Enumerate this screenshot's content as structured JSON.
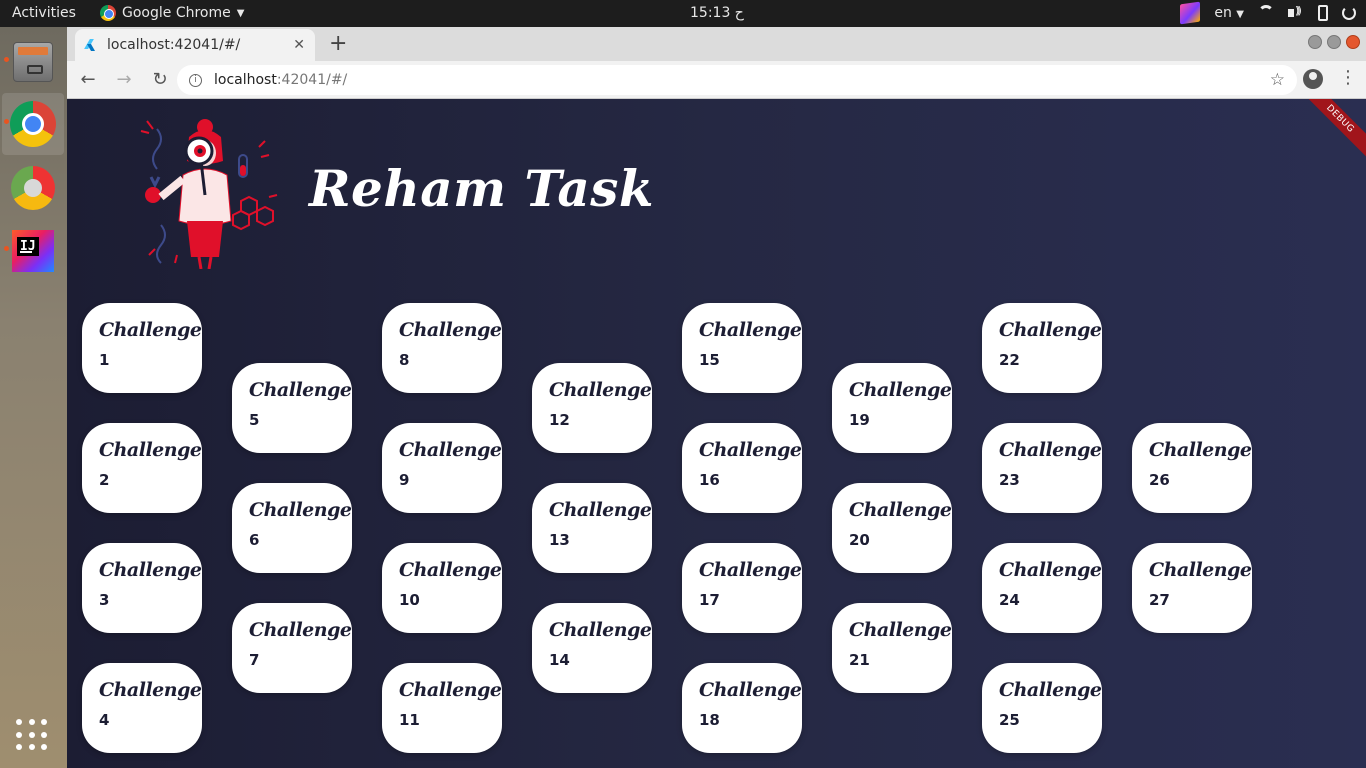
{
  "system_bar": {
    "activities": "Activities",
    "app_name": "Google Chrome",
    "clock": "15:13 ح",
    "language": "en"
  },
  "browser": {
    "tab_title": "localhost:42041/#/",
    "url_host": "localhost",
    "url_path": ":42041/#/"
  },
  "page": {
    "title": "Reham Task",
    "debug_banner": "DEBUG",
    "challenge_label": "Challenge",
    "challenges": [
      {
        "label": "Challenge",
        "number": "1"
      },
      {
        "label": "Challenge",
        "number": "2"
      },
      {
        "label": "Challenge",
        "number": "3"
      },
      {
        "label": "Challenge",
        "number": "4"
      },
      {
        "label": "Challenge",
        "number": "5"
      },
      {
        "label": "Challenge",
        "number": "6"
      },
      {
        "label": "Challenge",
        "number": "7"
      },
      {
        "label": "Challenge",
        "number": "8"
      },
      {
        "label": "Challenge",
        "number": "9"
      },
      {
        "label": "Challenge",
        "number": "10"
      },
      {
        "label": "Challenge",
        "number": "11"
      },
      {
        "label": "Challenge",
        "number": "12"
      },
      {
        "label": "Challenge",
        "number": "13"
      },
      {
        "label": "Challenge",
        "number": "14"
      },
      {
        "label": "Challenge",
        "number": "15"
      },
      {
        "label": "Challenge",
        "number": "16"
      },
      {
        "label": "Challenge",
        "number": "17"
      },
      {
        "label": "Challenge",
        "number": "18"
      },
      {
        "label": "Challenge",
        "number": "19"
      },
      {
        "label": "Challenge",
        "number": "20"
      },
      {
        "label": "Challenge",
        "number": "21"
      },
      {
        "label": "Challenge",
        "number": "22"
      },
      {
        "label": "Challenge",
        "number": "23"
      },
      {
        "label": "Challenge",
        "number": "24"
      },
      {
        "label": "Challenge",
        "number": "25"
      },
      {
        "label": "Challenge",
        "number": "26"
      },
      {
        "label": "Challenge",
        "number": "27"
      }
    ]
  },
  "colors": {
    "page_bg": "#252843",
    "card_bg": "#ffffff",
    "card_text": "#1c1d33",
    "debug_red": "#a1151b",
    "accent_red": "#e0102a"
  }
}
